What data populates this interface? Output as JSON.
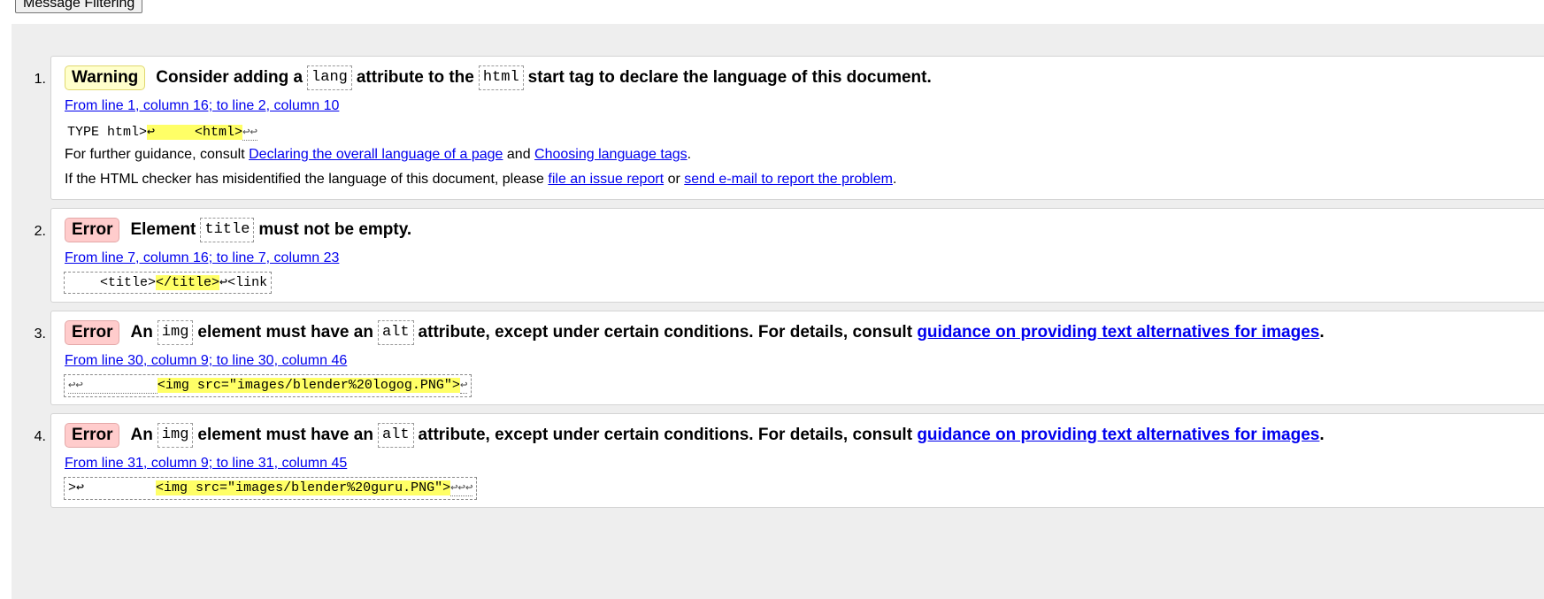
{
  "toolbar": {
    "filter_button": "Message Filtering"
  },
  "messages": [
    {
      "number": "1.",
      "type": "Warning",
      "parts": [
        "Consider adding a",
        "lang",
        "attribute to the",
        "html",
        "start tag to declare the language of this document."
      ],
      "location": "From line 1, column 16; to line 2, column 10",
      "extract": {
        "pre": "TYPE html>",
        "hl": "↩     <html>",
        "post": "↩↩"
      },
      "guidance": {
        "prefix": "For further guidance, consult",
        "link1": "Declaring the overall language of a page",
        "mid": "and",
        "link2": "Choosing language tags",
        "suffix": "."
      },
      "report": {
        "prefix": "If the HTML checker has misidentified the language of this document, please",
        "link1": "file an issue report",
        "mid": "or",
        "link2": "send e-mail to report the problem",
        "suffix": "."
      }
    },
    {
      "number": "2.",
      "type": "Error",
      "parts": [
        "Element",
        "title",
        "must not be empty."
      ],
      "location": "From line 7, column 16; to line 7, column 23",
      "extract": {
        "pre": "    <title>",
        "hl": "</title>",
        "post": "↩<link"
      }
    },
    {
      "number": "3.",
      "type": "Error",
      "parts": [
        "An",
        "img",
        "element must have an",
        "alt",
        "attribute, except under certain conditions. For details, consult"
      ],
      "link": "guidance on providing text alternatives for images",
      "suffix": ".",
      "location": "From line 30, column 9; to line 30, column 46",
      "extract": {
        "pre": "↩↩          ",
        "hl": "<img src=\"images/blender%20logog.PNG\">",
        "post": "↩"
      }
    },
    {
      "number": "4.",
      "type": "Error",
      "parts": [
        "An",
        "img",
        "element must have an",
        "alt",
        "attribute, except under certain conditions. For details, consult"
      ],
      "link": "guidance on providing text alternatives for images",
      "suffix": ".",
      "location": "From line 31, column 9; to line 31, column 45",
      "extract": {
        "pre": ">↩         ",
        "hl": "<img src=\"images/blender%20guru.PNG\">",
        "post": "↩↩↩"
      }
    }
  ]
}
